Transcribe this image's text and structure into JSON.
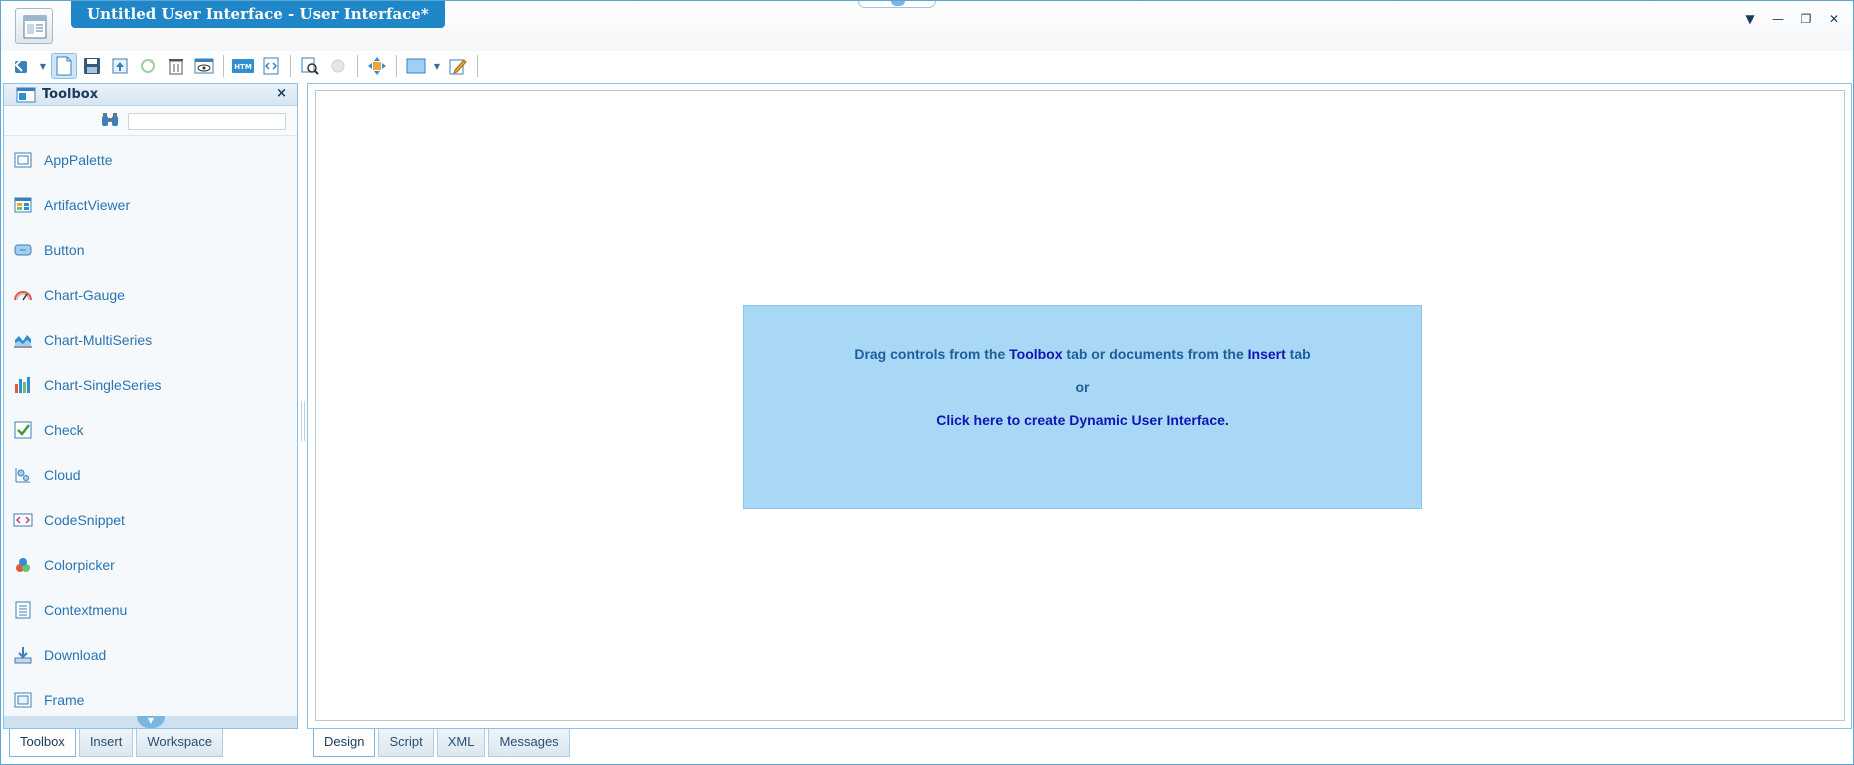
{
  "window": {
    "title": "Untitled User Interface - User Interface*"
  },
  "window_controls": [
    "▼",
    "—",
    "❐",
    "✕"
  ],
  "toolbox": {
    "title": "Toolbox",
    "close_glyph": "×",
    "search_placeholder": "",
    "items": [
      {
        "label": "AppPalette",
        "icon": "app-palette-icon"
      },
      {
        "label": "ArtifactViewer",
        "icon": "artifact-viewer-icon"
      },
      {
        "label": "Button",
        "icon": "button-icon"
      },
      {
        "label": "Chart-Gauge",
        "icon": "gauge-icon"
      },
      {
        "label": "Chart-MultiSeries",
        "icon": "area-chart-icon"
      },
      {
        "label": "Chart-SingleSeries",
        "icon": "bar-chart-icon"
      },
      {
        "label": "Check",
        "icon": "checkbox-icon"
      },
      {
        "label": "Cloud",
        "icon": "cloud-icon"
      },
      {
        "label": "CodeSnippet",
        "icon": "code-snippet-icon"
      },
      {
        "label": "Colorpicker",
        "icon": "colorpicker-icon"
      },
      {
        "label": "Contextmenu",
        "icon": "context-menu-icon"
      },
      {
        "label": "Download",
        "icon": "download-icon"
      },
      {
        "label": "Frame",
        "icon": "frame-icon"
      }
    ]
  },
  "left_tabs": [
    "Toolbox",
    "Insert",
    "Workspace"
  ],
  "design_tabs": [
    "Design",
    "Script",
    "XML",
    "Messages"
  ],
  "drop_zone": {
    "line1_a": "Drag controls from the ",
    "line1_b": "Toolbox",
    "line1_c": " tab or documents from the ",
    "line1_d": "Insert",
    "line1_e": " tab",
    "line2": "or",
    "line3": "Click here to create Dynamic User Interface."
  },
  "colors": {
    "accent": "#1f86c7",
    "drop_zone_bg": "#a9d8f7",
    "link": "#0d16b5",
    "tool_label": "#2a74b2"
  }
}
